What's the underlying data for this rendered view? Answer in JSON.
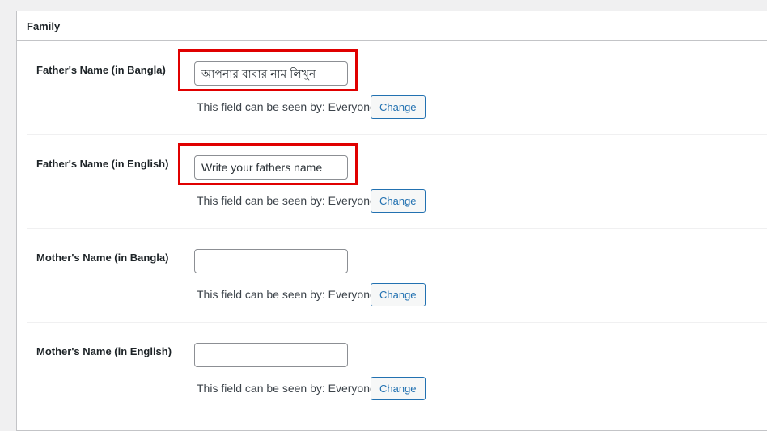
{
  "section": {
    "title": "Family"
  },
  "fields": [
    {
      "label": "Father's Name (in Bangla)",
      "placeholder": "আপনার বাবার নাম লিখুন",
      "value": "",
      "visibility_text": "This field can be seen by: Everyone",
      "change_label": "Change",
      "highlighted": true
    },
    {
      "label": "Father's Name (in English)",
      "placeholder": "Write your fathers name",
      "value": "",
      "visibility_text": "This field can be seen by: Everyone",
      "change_label": "Change",
      "highlighted": true
    },
    {
      "label": "Mother's Name (in Bangla)",
      "placeholder": "",
      "value": "",
      "visibility_text": "This field can be seen by: Everyone",
      "change_label": "Change",
      "highlighted": false
    },
    {
      "label": "Mother's Name (in English)",
      "placeholder": "",
      "value": "",
      "visibility_text": "This field can be seen by: Everyone",
      "change_label": "Change",
      "highlighted": false
    }
  ],
  "colors": {
    "highlight": "#e00000",
    "accent": "#2271b1"
  }
}
